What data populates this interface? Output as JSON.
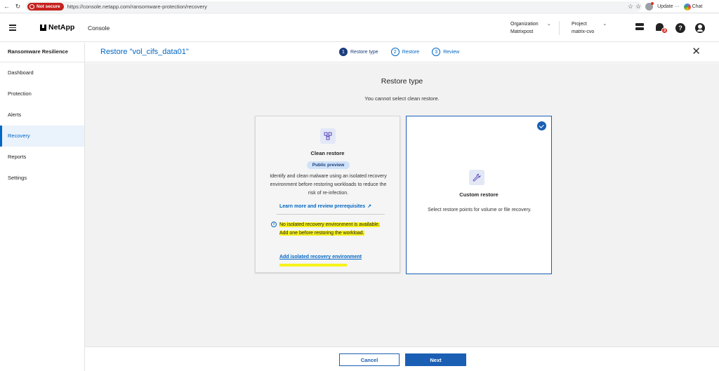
{
  "browser": {
    "not_secure_label": "Not secure",
    "url": "https://console.netapp.com/ransomware-protection/recovery",
    "update_label": "Update ···",
    "chat_label": "Chat"
  },
  "header": {
    "brand": "NetApp",
    "product": "Console",
    "organization_label": "Organization",
    "organization_value": "Matrixpost",
    "project_label": "Project",
    "project_value": "matrix-cvo",
    "notification_count": "3",
    "help_glyph": "?"
  },
  "sidebar": {
    "title": "Ransomware Resilience",
    "items": [
      {
        "label": "Dashboard"
      },
      {
        "label": "Protection"
      },
      {
        "label": "Alerts"
      },
      {
        "label": "Recovery"
      },
      {
        "label": "Reports"
      },
      {
        "label": "Settings"
      }
    ],
    "active_index": 3
  },
  "titlebar": {
    "title": "Restore \"vol_cifs_data01\"",
    "steps": [
      {
        "num": "1",
        "label": "Restore type"
      },
      {
        "num": "2",
        "label": "Restore"
      },
      {
        "num": "3",
        "label": "Review"
      }
    ],
    "close_glyph": "✕"
  },
  "main": {
    "heading": "Restore type",
    "subheading": "You cannot select clean restore.",
    "clean_card": {
      "title": "Clean restore",
      "badge": "Public preview",
      "description": "Identify and clean malware using an isolated recovery environment before restoring workloads to reduce the risk of re-infection.",
      "learn_link": "Learn more and review prerequisites",
      "warning": "No isolated recovery environment is available. Add one before restoring the workload.",
      "add_link": "Add isolated recovery environment"
    },
    "custom_card": {
      "title": "Custom restore",
      "description": "Select restore points for volume or file recovery.",
      "selected": true
    }
  },
  "footer": {
    "cancel_label": "Cancel",
    "next_label": "Next"
  },
  "colors": {
    "accent": "#0067c5",
    "primary_button": "#1a5fb4",
    "highlight": "#f7f21a",
    "not_secure": "#c5221f"
  }
}
